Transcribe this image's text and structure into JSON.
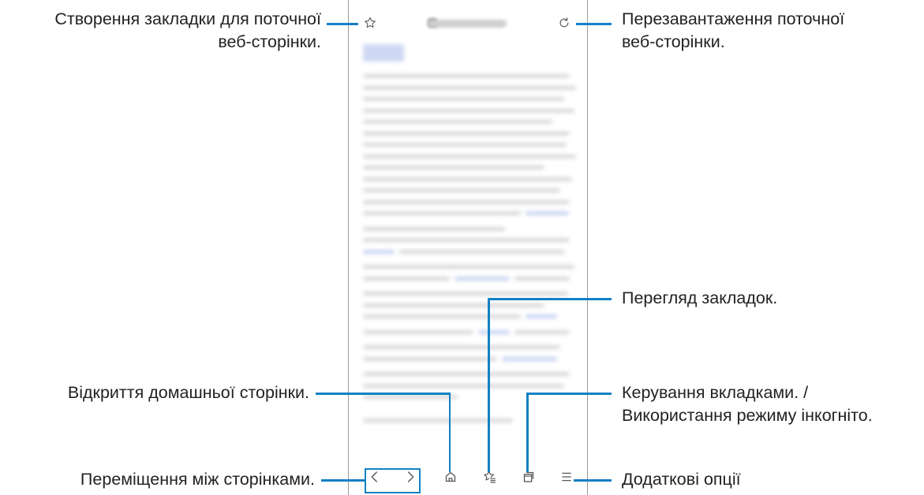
{
  "annotations": {
    "bookmark_create": {
      "line1": "Створення закладки для поточної",
      "line2": "веб-сторінки."
    },
    "reload": {
      "line1": "Перезавантаження поточної",
      "line2": "веб-сторінки."
    },
    "bookmarks_view": {
      "line1": "Перегляд закладок."
    },
    "home": {
      "line1": "Відкриття домашньої сторінки."
    },
    "tabs": {
      "line1": "Керування вкладками. /",
      "line2": "Використання режиму інкогніто."
    },
    "navigate": {
      "line1": "Переміщення між сторінками."
    },
    "more": {
      "line1": "Додаткові опції"
    }
  },
  "browser": {
    "top_toolbar": {
      "left_icon": "star-outline-icon",
      "right_icon": "reload-icon"
    },
    "bottom_toolbar": {
      "items": [
        "chevron-left-icon",
        "chevron-right-icon",
        "home-icon",
        "bookmarks-icon",
        "tabs-icon",
        "menu-icon"
      ]
    }
  },
  "colors": {
    "callout": "#1280c6",
    "frame": "#9a9a9a",
    "icon": "#555555"
  }
}
